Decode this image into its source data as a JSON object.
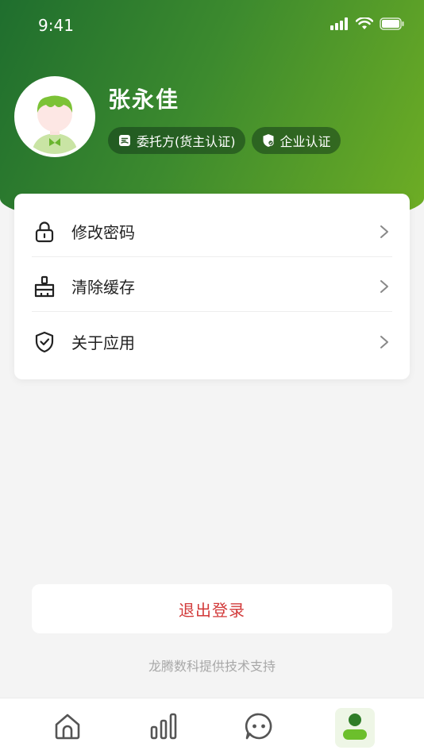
{
  "status_bar": {
    "time": "9:41"
  },
  "profile": {
    "name": "张永佳",
    "badges": [
      {
        "label": "委托方(货主认证)",
        "icon": "document-icon"
      },
      {
        "label": "企业认证",
        "icon": "shield-check-icon"
      }
    ]
  },
  "menu": {
    "items": [
      {
        "label": "修改密码",
        "icon": "lock-icon"
      },
      {
        "label": "清除缓存",
        "icon": "broom-icon"
      },
      {
        "label": "关于应用",
        "icon": "shield-icon"
      }
    ]
  },
  "logout_label": "退出登录",
  "support_text": "龙腾数科提供技术支持",
  "tabbar": {
    "tabs": [
      {
        "name": "home",
        "icon": "home-icon"
      },
      {
        "name": "stats",
        "icon": "bar-chart-icon"
      },
      {
        "name": "messages",
        "icon": "chat-icon"
      },
      {
        "name": "profile",
        "icon": "user-icon",
        "active": true
      }
    ]
  },
  "colors": {
    "header_start": "#1f6e2e",
    "header_end": "#6fae24",
    "logout_text": "#d23a3a",
    "active_tab": "#3d8f2a"
  }
}
